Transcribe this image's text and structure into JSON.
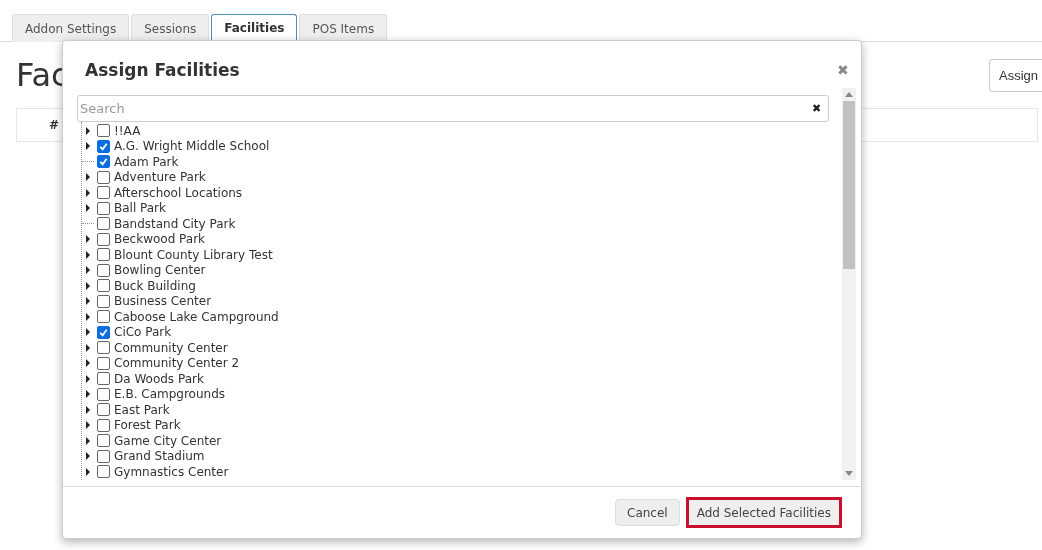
{
  "tabs": [
    {
      "label": "Addon Settings",
      "selected": false
    },
    {
      "label": "Sessions",
      "selected": false
    },
    {
      "label": "Facilities",
      "selected": true
    },
    {
      "label": "POS Items",
      "selected": false
    }
  ],
  "page": {
    "heading": "Fac",
    "assign_button": "Assign",
    "table_header": "#"
  },
  "dialog": {
    "title": "Assign Facilities",
    "close": "✖",
    "search": {
      "placeholder": "Search",
      "clear": "✖"
    },
    "items": [
      {
        "label": "!!AA",
        "expandable": true,
        "checked": false
      },
      {
        "label": "A.G. Wright Middle School",
        "expandable": true,
        "checked": true
      },
      {
        "label": "Adam Park",
        "expandable": false,
        "checked": true
      },
      {
        "label": "Adventure Park",
        "expandable": true,
        "checked": false
      },
      {
        "label": "Afterschool Locations",
        "expandable": true,
        "checked": false
      },
      {
        "label": "Ball Park",
        "expandable": true,
        "checked": false
      },
      {
        "label": "Bandstand City Park",
        "expandable": false,
        "checked": false
      },
      {
        "label": "Beckwood Park",
        "expandable": true,
        "checked": false
      },
      {
        "label": "Blount County Library Test",
        "expandable": true,
        "checked": false
      },
      {
        "label": "Bowling Center",
        "expandable": true,
        "checked": false
      },
      {
        "label": "Buck Building",
        "expandable": true,
        "checked": false
      },
      {
        "label": "Business Center",
        "expandable": true,
        "checked": false
      },
      {
        "label": "Caboose Lake Campground",
        "expandable": true,
        "checked": false
      },
      {
        "label": "CiCo Park",
        "expandable": true,
        "checked": true
      },
      {
        "label": "Community Center",
        "expandable": true,
        "checked": false
      },
      {
        "label": "Community Center 2",
        "expandable": true,
        "checked": false
      },
      {
        "label": "Da Woods Park",
        "expandable": true,
        "checked": false
      },
      {
        "label": "E.B. Campgrounds",
        "expandable": true,
        "checked": false
      },
      {
        "label": "East Park",
        "expandable": true,
        "checked": false
      },
      {
        "label": "Forest Park",
        "expandable": true,
        "checked": false
      },
      {
        "label": "Game City Center",
        "expandable": true,
        "checked": false
      },
      {
        "label": "Grand Stadium",
        "expandable": true,
        "checked": false
      },
      {
        "label": "Gymnastics Center",
        "expandable": true,
        "checked": false
      }
    ],
    "buttons": [
      {
        "label": "Cancel",
        "highlighted": false
      },
      {
        "label": "Add Selected Facilities",
        "highlighted": true
      }
    ]
  }
}
